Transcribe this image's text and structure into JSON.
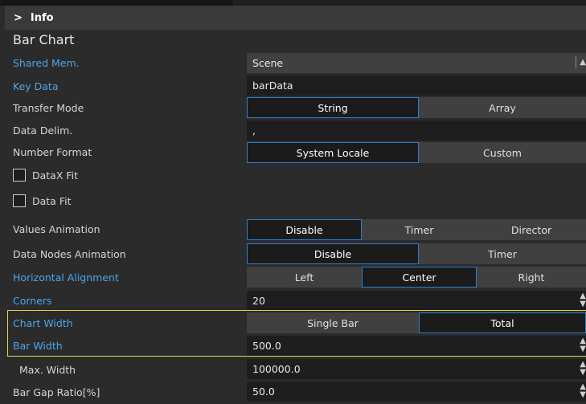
{
  "panel": {
    "info_label": "Info",
    "section_title": "Bar Chart"
  },
  "rows": {
    "shared_mem": {
      "label": "Shared Mem.",
      "value": "Scene"
    },
    "key_data": {
      "label": "Key Data",
      "value": "barData"
    },
    "transfer_mode": {
      "label": "Transfer Mode",
      "options": [
        "String",
        "Array"
      ],
      "selected": "String"
    },
    "data_delim": {
      "label": "Data Delim.",
      "value": ","
    },
    "number_format": {
      "label": "Number Format",
      "options": [
        "System Locale",
        "Custom"
      ],
      "selected": "System Locale"
    },
    "datax_fit": {
      "label": "DataX Fit",
      "checked": false
    },
    "data_fit": {
      "label": "Data Fit",
      "checked": false
    },
    "values_animation": {
      "label": "Values Animation",
      "options": [
        "Disable",
        "Timer",
        "Director"
      ],
      "selected": "Disable"
    },
    "data_nodes_animation": {
      "label": "Data Nodes Animation",
      "options": [
        "Disable",
        "Timer"
      ],
      "selected": "Disable"
    },
    "horizontal_alignment": {
      "label": "Horizontal Alignment",
      "options": [
        "Left",
        "Center",
        "Right"
      ],
      "selected": "Center"
    },
    "corners": {
      "label": "Corners",
      "value": "20"
    },
    "chart_width": {
      "label": "Chart Width",
      "options": [
        "Single Bar",
        "Total"
      ],
      "selected": "Total"
    },
    "bar_width": {
      "label": "Bar Width",
      "value": "500.0"
    },
    "max_width": {
      "label": "Max. Width",
      "value": "100000.0"
    },
    "bar_gap_ratio": {
      "label": "Bar Gap Ratio[%]",
      "value": "50.0"
    }
  },
  "colors": {
    "background": "#2b2b2b",
    "linked_label": "#4da6e8",
    "active_border": "#2d7fd1",
    "highlight_border": "#e0d24b"
  },
  "icons": {
    "expand": "chevron-right-icon",
    "spinner": "spinner-arrows-icon",
    "dropdown": "dropdown-arrows-icon"
  }
}
